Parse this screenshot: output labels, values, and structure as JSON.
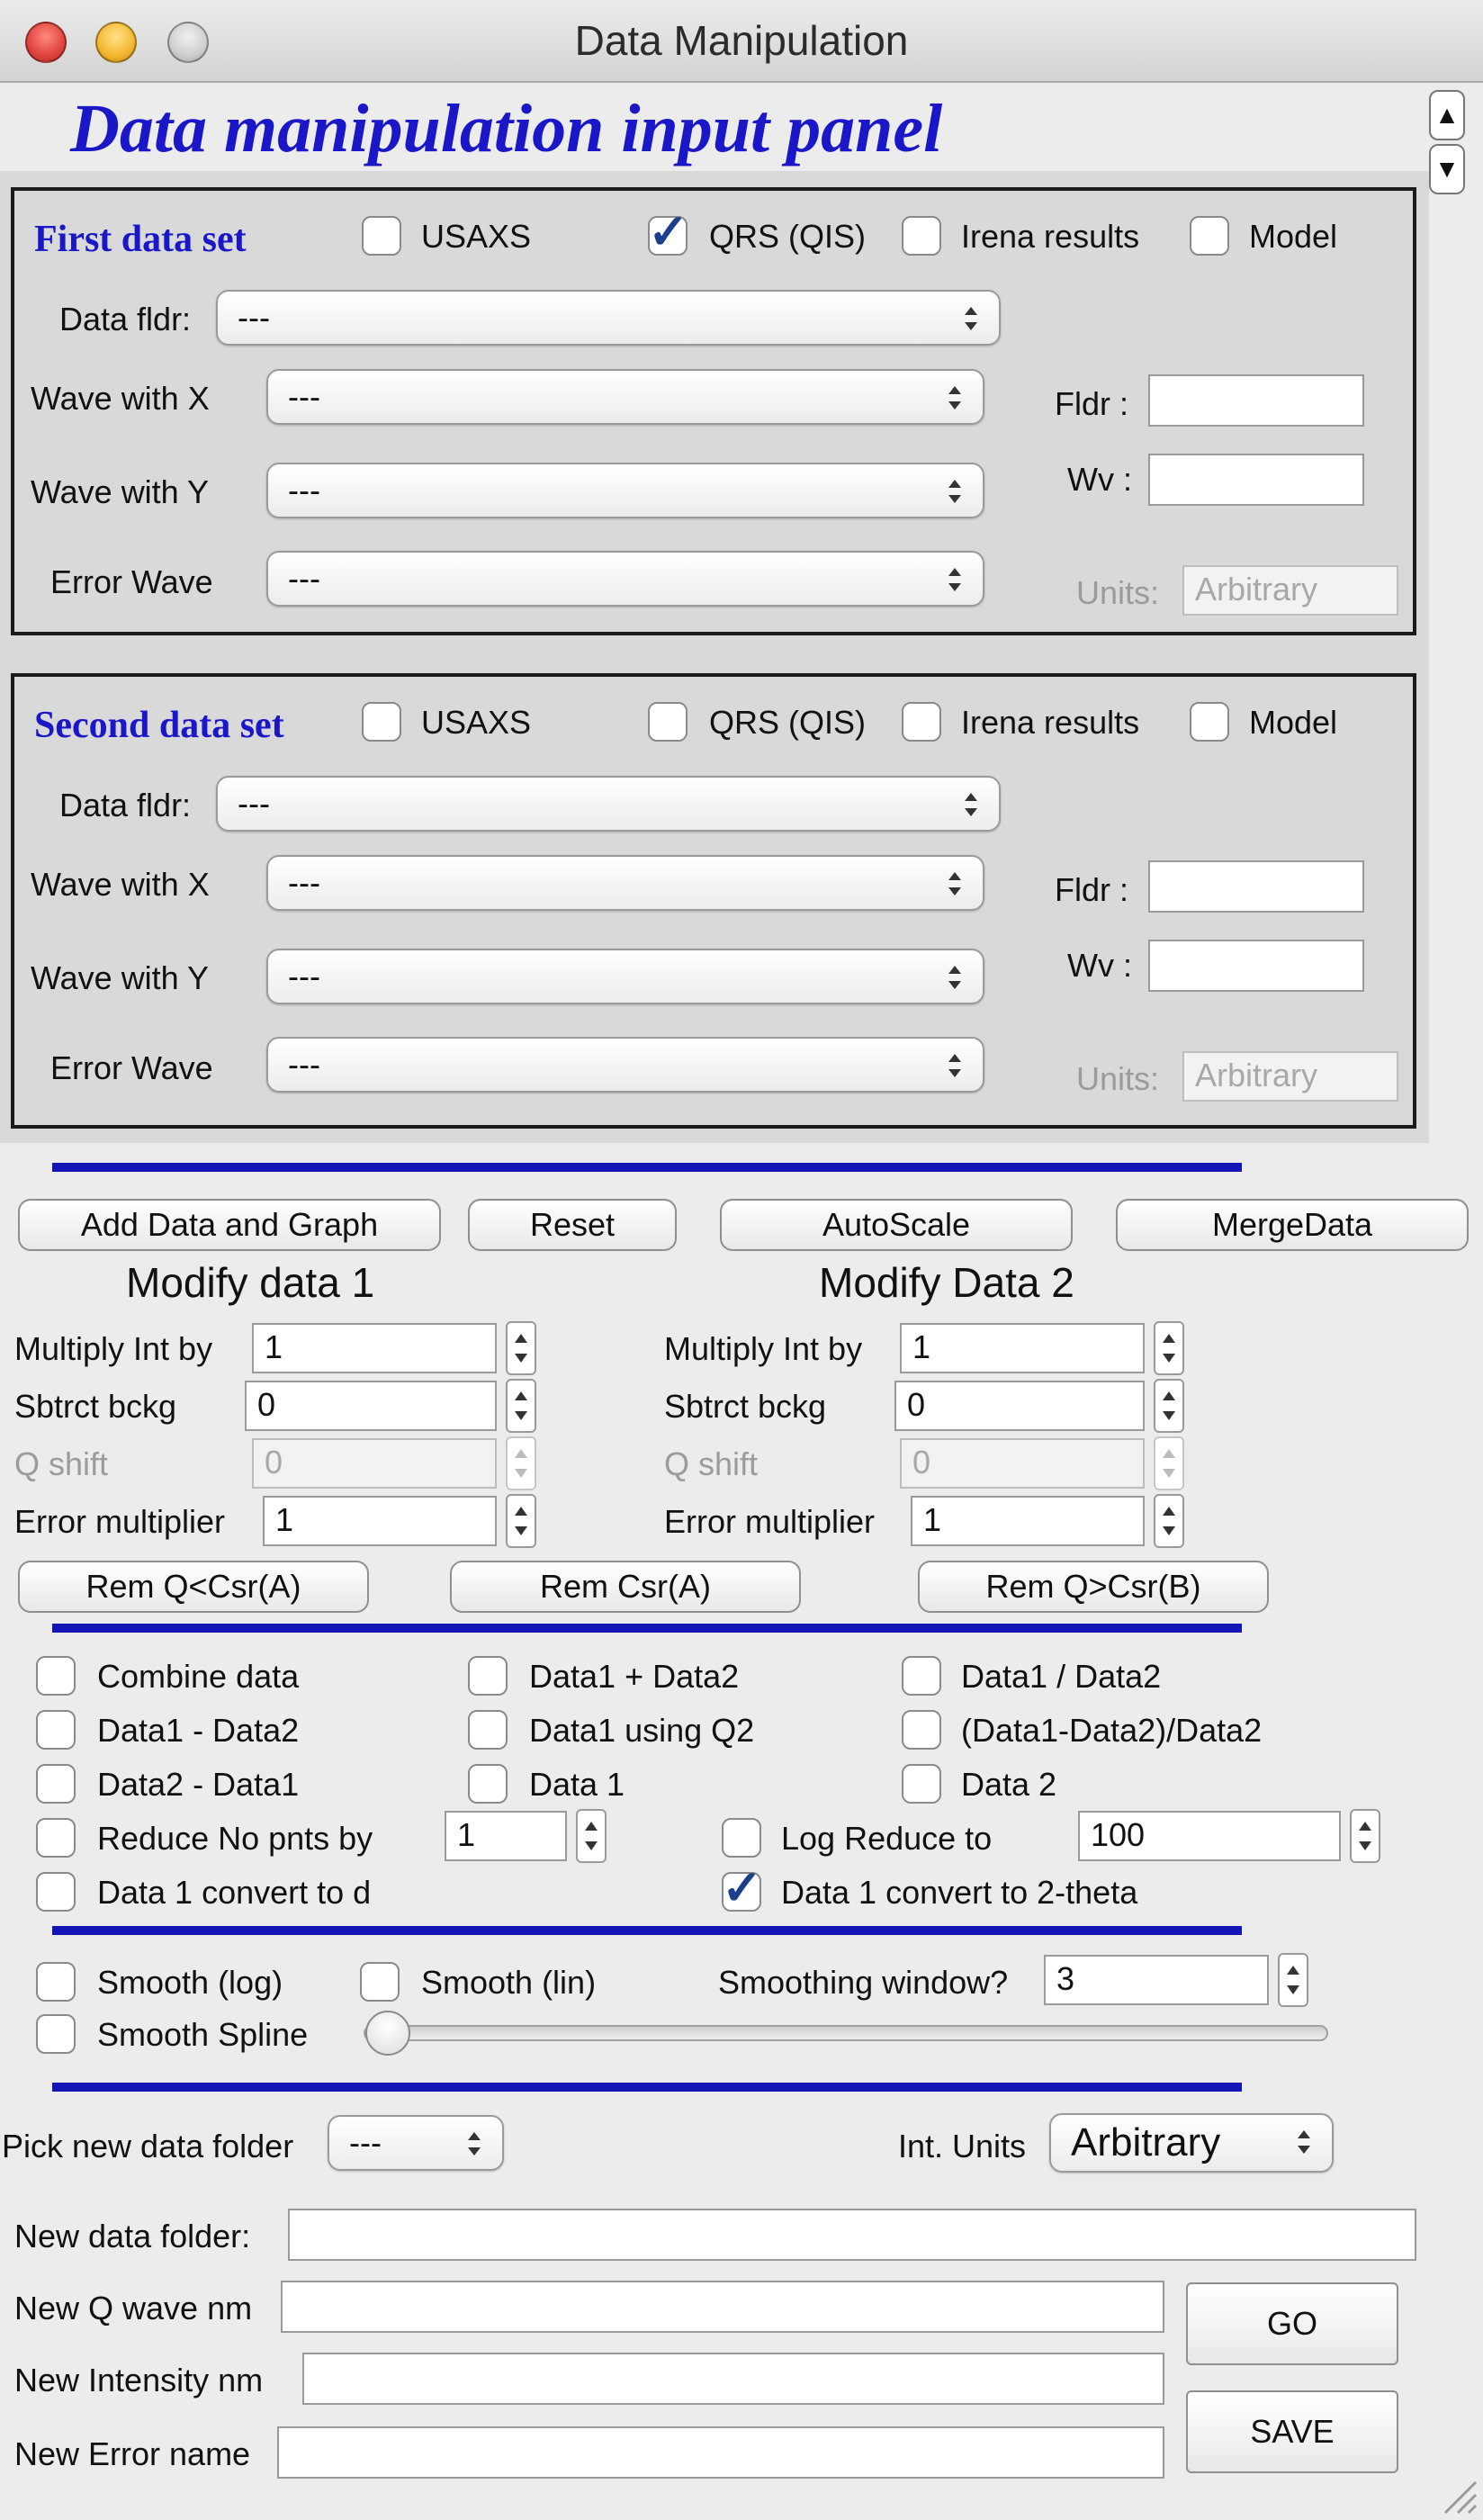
{
  "window": {
    "title": "Data Manipulation"
  },
  "panel_heading": "Data manipulation input panel",
  "icons": {
    "scroll_up": "▲",
    "scroll_down": "▼",
    "checkmark": "✓"
  },
  "colors": {
    "heading_blue": "#1a17c9",
    "separator_blue": "#1414b8"
  },
  "first_set": {
    "title": "First data set",
    "checkboxes": [
      {
        "label": "USAXS",
        "checked": false
      },
      {
        "label": "QRS (QIS)",
        "checked": true
      },
      {
        "label": "Irena results",
        "checked": false
      },
      {
        "label": "Model",
        "checked": false
      }
    ],
    "data_fldr_label": "Data fldr:",
    "data_fldr_value": "---",
    "wave_x_label": "Wave with X",
    "wave_x_value": "---",
    "wave_y_label": "Wave with Y",
    "wave_y_value": "---",
    "error_wave_label": "Error Wave",
    "error_wave_value": "---",
    "fldr_label": "Fldr :",
    "fldr_value": "",
    "wv_label": "Wv :",
    "wv_value": "",
    "units_label": "Units:",
    "units_value": "Arbitrary"
  },
  "second_set": {
    "title": "Second data set",
    "checkboxes": [
      {
        "label": "USAXS",
        "checked": false
      },
      {
        "label": "QRS (QIS)",
        "checked": false
      },
      {
        "label": "Irena results",
        "checked": false
      },
      {
        "label": "Model",
        "checked": false
      }
    ],
    "data_fldr_label": "Data fldr:",
    "data_fldr_value": "---",
    "wave_x_label": "Wave with X",
    "wave_x_value": "---",
    "wave_y_label": "Wave with Y",
    "wave_y_value": "---",
    "error_wave_label": "Error Wave",
    "error_wave_value": "---",
    "fldr_label": "Fldr :",
    "fldr_value": "",
    "wv_label": "Wv :",
    "wv_value": "",
    "units_label": "Units:",
    "units_value": "Arbitrary"
  },
  "actions": {
    "add_data_graph": "Add Data and Graph",
    "reset": "Reset",
    "autoscale": "AutoScale",
    "merge_data": "MergeData"
  },
  "modify1": {
    "title": "Modify data 1",
    "multiply_label": "Multiply Int by",
    "multiply_value": "1",
    "sbtrct_label": "Sbtrct bckg",
    "sbtrct_value": "0",
    "qshift_label": "Q shift",
    "qshift_value": "0",
    "errmult_label": "Error multiplier",
    "errmult_value": "1"
  },
  "modify2": {
    "title": "Modify Data 2",
    "multiply_label": "Multiply Int by",
    "multiply_value": "1",
    "sbtrct_label": "Sbtrct bckg",
    "sbtrct_value": "0",
    "qshift_label": "Q shift",
    "qshift_value": "0",
    "errmult_label": "Error multiplier",
    "errmult_value": "1"
  },
  "cursor_buttons": {
    "rem_q_lt_csr_a": "Rem Q<Csr(A)",
    "rem_csr_a": "Rem Csr(A)",
    "rem_q_gt_csr_b": "Rem Q>Csr(B)"
  },
  "operations": {
    "combine": "Combine data",
    "d1_plus_d2": "Data1 + Data2",
    "d1_div_d2": "Data1 / Data2",
    "d1_minus_d2": "Data1 - Data2",
    "d1_using_q2": "Data1 using Q2",
    "rel_diff": "(Data1-Data2)/Data2",
    "d2_minus_d1": "Data2 - Data1",
    "data1": "Data 1",
    "data2": "Data 2",
    "reduce_label": "Reduce No pnts by",
    "reduce_value": "1",
    "log_reduce_label": "Log Reduce to",
    "log_reduce_value": "100",
    "convert_d": "Data 1 convert to d",
    "convert_2theta": "Data 1 convert to 2-theta",
    "convert_2theta_checked": true
  },
  "smoothing": {
    "smooth_log": "Smooth (log)",
    "smooth_lin": "Smooth (lin)",
    "window_label": "Smoothing window?",
    "window_value": "3",
    "spline": "Smooth Spline",
    "slider_value": 0
  },
  "output": {
    "pick_folder_label": "Pick new data folder",
    "pick_folder_value": "---",
    "int_units_label": "Int. Units",
    "int_units_value": "Arbitrary",
    "new_folder_label": "New data folder:",
    "new_folder_value": "",
    "new_q_label": "New Q wave nm",
    "new_q_value": "",
    "new_int_label": "New Intensity nm",
    "new_int_value": "",
    "new_err_label": "New Error name",
    "new_err_value": "",
    "go": "GO",
    "save": "SAVE"
  }
}
